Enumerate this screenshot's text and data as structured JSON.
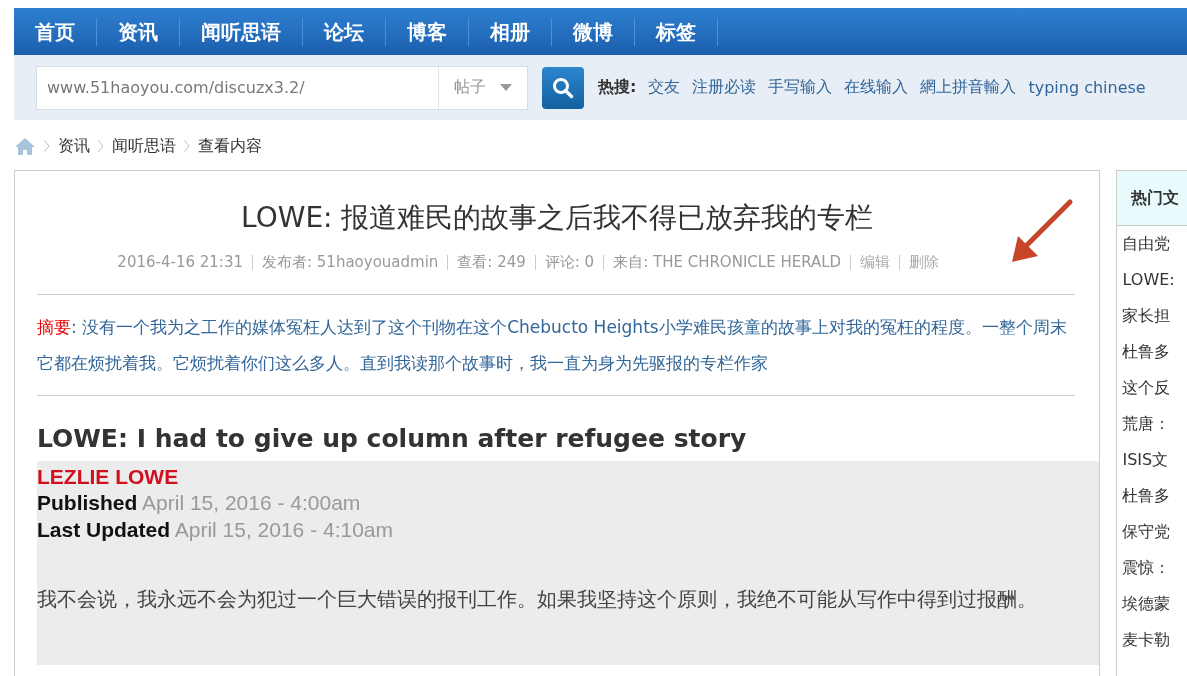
{
  "nav": {
    "items": [
      {
        "label": "首页",
        "selected": false
      },
      {
        "label": "资讯",
        "selected": false
      },
      {
        "label": "闻听思语",
        "selected": false
      },
      {
        "label": "论坛",
        "selected": false
      },
      {
        "label": "博客",
        "selected": false
      },
      {
        "label": "相册",
        "selected": false
      },
      {
        "label": "微博",
        "selected": false
      },
      {
        "label": "标签",
        "selected": false
      }
    ]
  },
  "search": {
    "value": "www.51haoyou.com/discuzx3.2/",
    "scope": "帖子",
    "hot_label": "热搜:",
    "hot_links": [
      "交友",
      "注册必读",
      "手写输入",
      "在线输入",
      "網上拼音輸入",
      "typing chinese"
    ]
  },
  "breadcrumb": [
    "资讯",
    "闻听思语",
    "查看内容"
  ],
  "article": {
    "title": "LOWE: 报道难民的故事之后我不得已放弃我的专栏",
    "meta": [
      {
        "kind": "text",
        "text": "2016-4-16 21:31"
      },
      {
        "kind": "text",
        "text": "发布者: 51haoyouadmin"
      },
      {
        "kind": "text",
        "text": "查看: 249"
      },
      {
        "kind": "text",
        "text": "评论: 0"
      },
      {
        "kind": "text",
        "text": "来自: THE CHRONICLE HERALD"
      },
      {
        "kind": "link",
        "text": "编辑"
      },
      {
        "kind": "link",
        "text": "删除"
      }
    ],
    "summary": {
      "label": "摘要",
      "text": ": 没有一个我为之工作的媒体冤枉人达到了这个刊物在这个Chebucto Heights小学难民孩童的故事上对我的冤枉的程度。一整个周末它都在烦扰着我。它烦扰着你们这么多人。直到我读那个故事时，我一直为身为先驱报的专栏作家"
    },
    "heading": "LOWE: I had to give up column after refugee story",
    "author": "LEZLIE LOWE",
    "dates": [
      {
        "label": "Published",
        "value": "April 15, 2016 - 4:00am"
      },
      {
        "label": "Last Updated",
        "value": "April 15, 2016 - 4:10am"
      }
    ],
    "body": "我不会说，我永远不会为犯过一个巨大错误的报刊工作。如果我坚持这个原则，我绝不可能从写作中得到过报酬。"
  },
  "sidebar": {
    "title": "热门文",
    "items": [
      "自由党",
      "LOWE:",
      "家长担",
      "杜鲁多",
      "这个反",
      "荒唐：",
      "ISIS文",
      "杜鲁多",
      "保守党",
      "震惊：",
      "埃德蒙",
      "麦卡勒"
    ]
  }
}
